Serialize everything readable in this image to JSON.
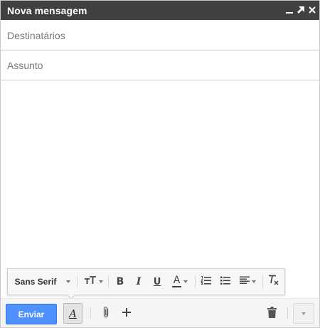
{
  "window": {
    "title": "Nova mensagem",
    "controls": [
      "minimize-icon",
      "expand-icon",
      "close-icon"
    ]
  },
  "fields": {
    "to_placeholder": "Destinatários",
    "to_value": "",
    "subject_placeholder": "Assunto",
    "subject_value": ""
  },
  "body": {
    "text": ""
  },
  "formatting": {
    "font_family": "Sans Serif",
    "buttons": [
      "font-family",
      "font-size-icon",
      "bold-icon",
      "italic-icon",
      "underline-icon",
      "text-color-icon",
      "numbered-list-icon",
      "bulleted-list-icon",
      "align-icon",
      "remove-formatting-icon"
    ],
    "bold_label": "B",
    "italic_label": "I",
    "underline_label": "U",
    "text_color_label": "A",
    "text_color": "#444444"
  },
  "bottom_bar": {
    "send_label": "Enviar",
    "formatting_toggle_label": "A",
    "icons": [
      "attach-icon",
      "plus-icon",
      "trash-icon",
      "more-options-icon"
    ]
  },
  "colors": {
    "titlebar": "#404040",
    "send_button": "#4d90fe",
    "send_border": "#3079ed"
  }
}
